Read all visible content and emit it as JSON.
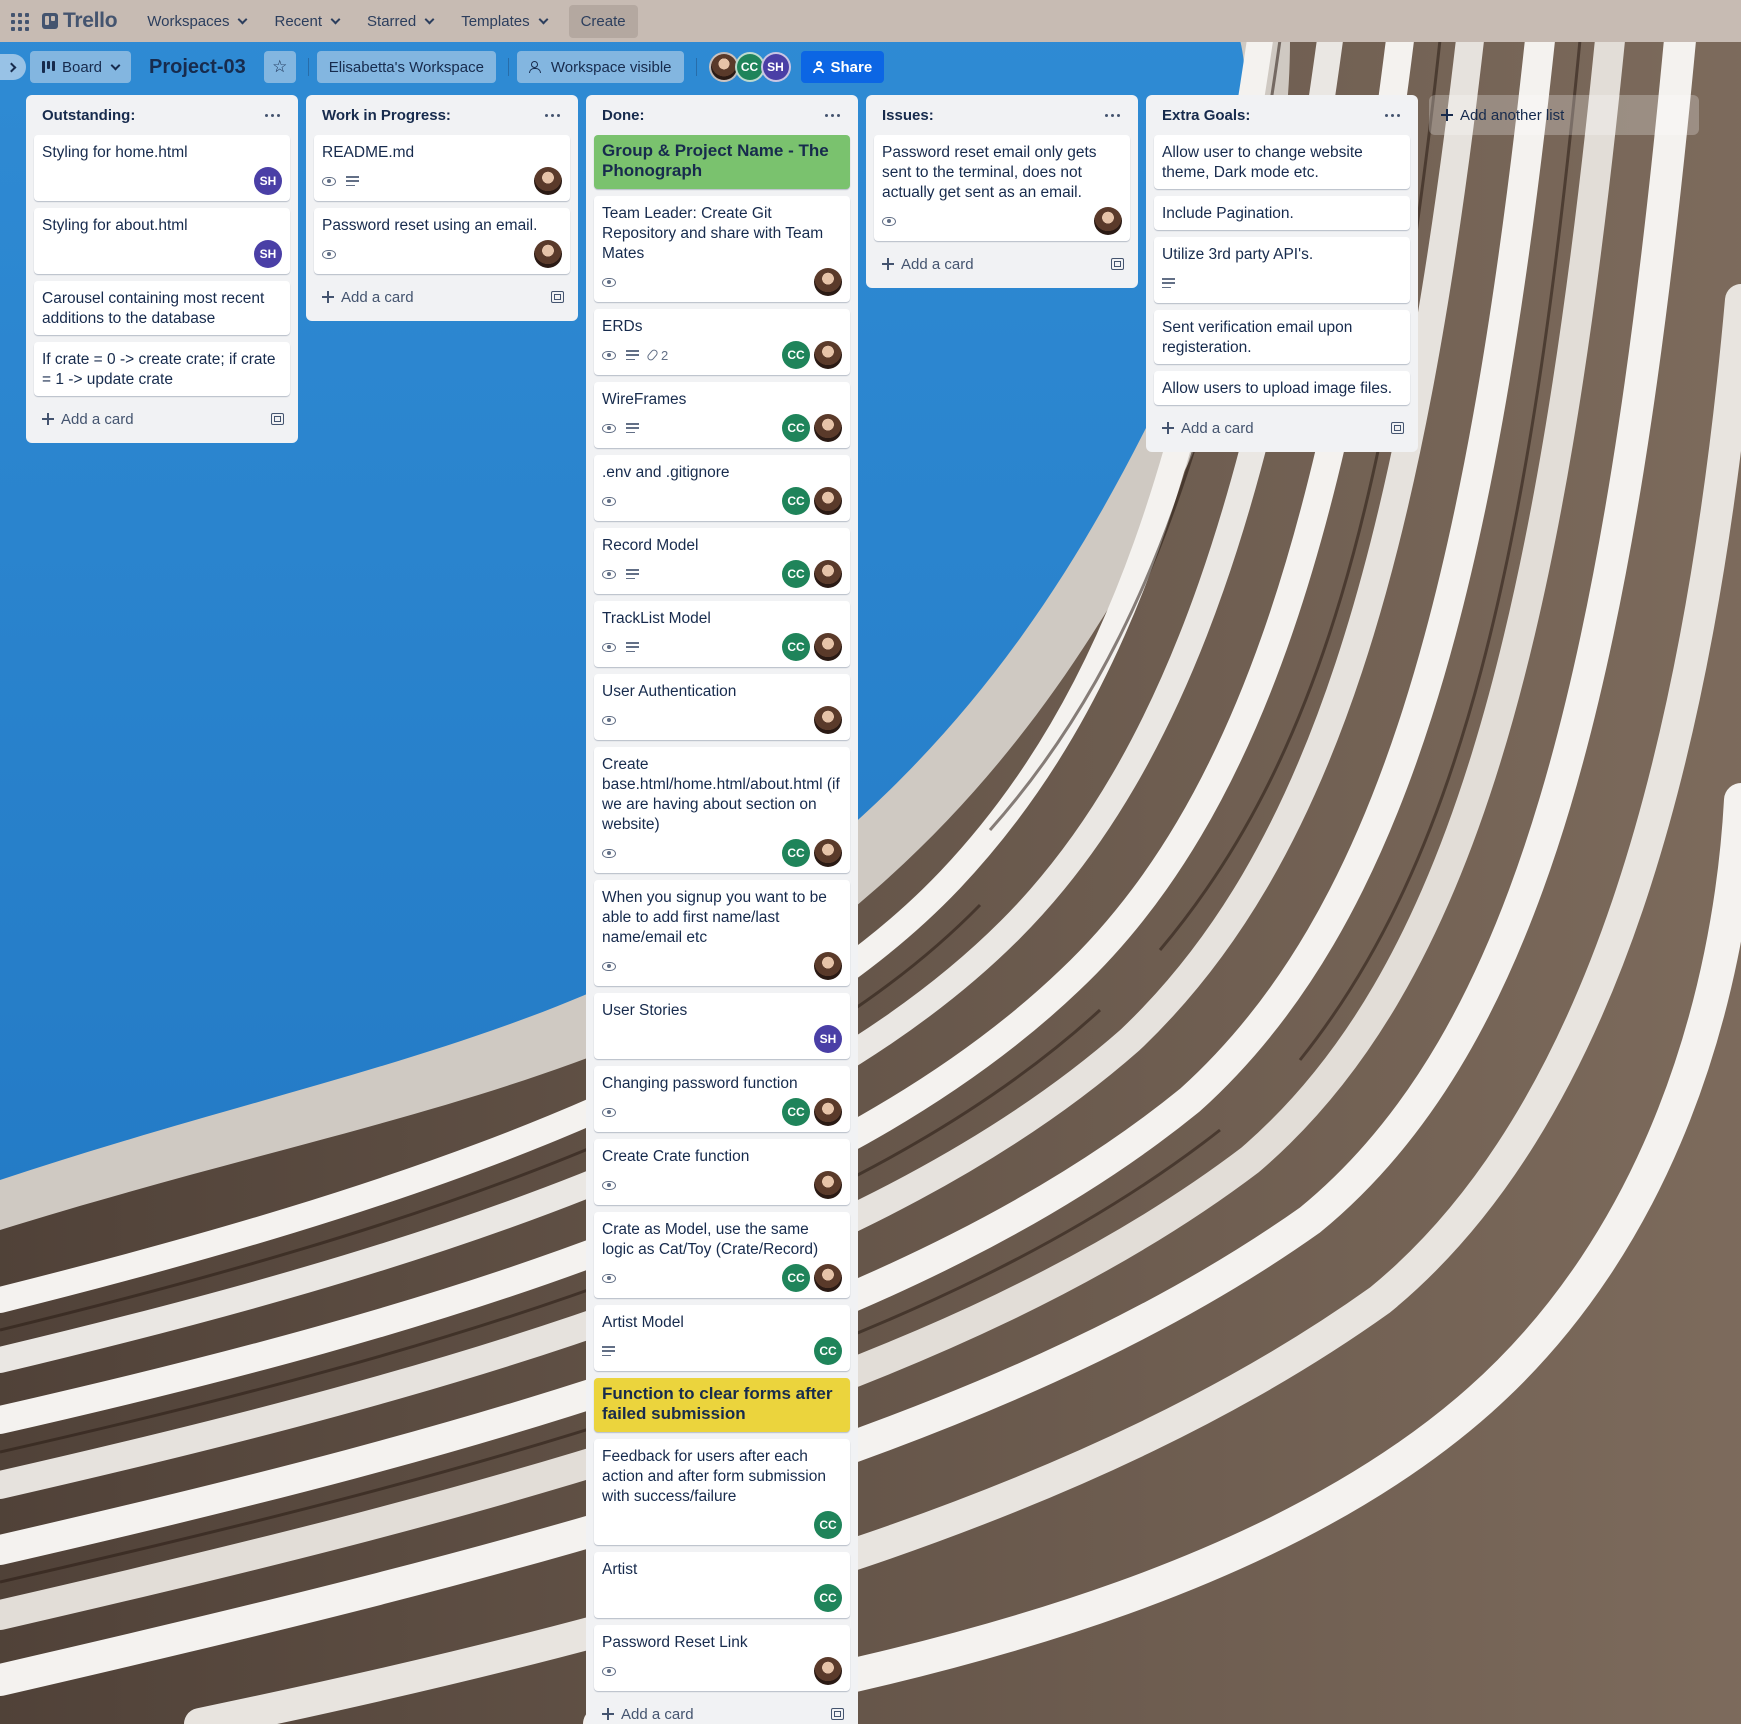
{
  "nav": {
    "logo": "Trello",
    "items": [
      "Workspaces",
      "Recent",
      "Starred",
      "Templates"
    ],
    "create_label": "Create"
  },
  "board": {
    "view_label": "Board",
    "title": "Project-03",
    "workspace_label": "Elisabetta's Workspace",
    "visibility_label": "Workspace visible",
    "share_label": "Share",
    "members": [
      "photo",
      "CC",
      "SH"
    ]
  },
  "add_list_label": "Add another list",
  "add_card_label": "Add a card",
  "lists": [
    {
      "title": "Outstanding:",
      "cards": [
        {
          "title": "Styling for home.html",
          "badges": [],
          "members": [
            "SH"
          ]
        },
        {
          "title": "Styling for about.html",
          "badges": [],
          "members": [
            "SH"
          ]
        },
        {
          "title": "Carousel containing most recent additions to the database",
          "badges": [],
          "members": []
        },
        {
          "title": "If crate = 0 -> create crate; if crate = 1 -> update crate",
          "badges": [],
          "members": []
        }
      ]
    },
    {
      "title": "Work in Progress:",
      "cards": [
        {
          "title": "README.md",
          "badges": [
            "eye",
            "desc"
          ],
          "members": [
            "photo"
          ]
        },
        {
          "title": "Password reset using an email.",
          "badges": [
            "eye"
          ],
          "members": [
            "photo"
          ]
        }
      ]
    },
    {
      "title": "Done:",
      "cards": [
        {
          "title": "Group & Project Name - The Phonograph",
          "cover": "green",
          "badges": [],
          "members": []
        },
        {
          "title": "Team Leader: Create Git Repository and share with Team Mates",
          "badges": [
            "eye"
          ],
          "members": [
            "photo"
          ]
        },
        {
          "title": "ERDs",
          "badges": [
            "eye",
            "desc",
            "attach"
          ],
          "attachments": "2",
          "members": [
            "CC",
            "photo"
          ]
        },
        {
          "title": "WireFrames",
          "badges": [
            "eye",
            "desc"
          ],
          "members": [
            "CC",
            "photo"
          ]
        },
        {
          "title": ".env and .gitignore",
          "badges": [
            "eye"
          ],
          "members": [
            "CC",
            "photo"
          ]
        },
        {
          "title": "Record Model",
          "badges": [
            "eye",
            "desc"
          ],
          "members": [
            "CC",
            "photo"
          ]
        },
        {
          "title": "TrackList Model",
          "badges": [
            "eye",
            "desc"
          ],
          "members": [
            "CC",
            "photo"
          ]
        },
        {
          "title": "User Authentication",
          "badges": [
            "eye"
          ],
          "members": [
            "photo"
          ]
        },
        {
          "title": "Create base.html/home.html/about.html (if we are having about section on website)",
          "badges": [
            "eye"
          ],
          "members": [
            "CC",
            "photo"
          ]
        },
        {
          "title": "When you signup you want to be able to add first name/last name/email etc",
          "badges": [
            "eye"
          ],
          "members": [
            "photo"
          ]
        },
        {
          "title": "User Stories",
          "badges": [],
          "members": [
            "SH"
          ]
        },
        {
          "title": "Changing password function",
          "badges": [
            "eye"
          ],
          "members": [
            "CC",
            "photo"
          ]
        },
        {
          "title": "Create Crate function",
          "badges": [
            "eye"
          ],
          "members": [
            "photo"
          ]
        },
        {
          "title": "Crate as Model, use the same logic as Cat/Toy (Crate/Record)",
          "badges": [
            "eye"
          ],
          "members": [
            "CC",
            "photo"
          ]
        },
        {
          "title": "Artist Model",
          "badges": [
            "desc"
          ],
          "members": [
            "CC"
          ]
        },
        {
          "title": "Function to clear forms after failed submission",
          "cover": "yellow",
          "badges": [],
          "members": []
        },
        {
          "title": "Feedback for users after each action and after form submission with success/failure",
          "badges": [],
          "members": [
            "CC"
          ]
        },
        {
          "title": "Artist",
          "badges": [],
          "members": [
            "CC"
          ]
        },
        {
          "title": "Password Reset Link",
          "badges": [
            "eye"
          ],
          "members": [
            "photo"
          ]
        }
      ]
    },
    {
      "title": "Issues:",
      "cards": [
        {
          "title": "Password reset email only gets sent to the terminal, does not actually get sent as an email.",
          "badges": [
            "eye"
          ],
          "members": [
            "photo"
          ]
        }
      ]
    },
    {
      "title": "Extra Goals:",
      "cards": [
        {
          "title": "Allow user to change website theme, Dark mode etc.",
          "badges": [],
          "members": []
        },
        {
          "title": "Include Pagination.",
          "badges": [],
          "members": []
        },
        {
          "title": "Utilize 3rd party API's.",
          "badges": [
            "desc"
          ],
          "members": []
        },
        {
          "title": "Sent verification email upon registeration.",
          "badges": [],
          "members": []
        },
        {
          "title": "Allow users to upload image files.",
          "badges": [],
          "members": []
        }
      ]
    }
  ],
  "colors": {
    "share": "#0c66e4",
    "cc_avatar": "#1f845a",
    "sh_avatar": "#4a3fa6",
    "cover_green": "#7ac26e",
    "cover_yellow": "#ebd43d"
  }
}
